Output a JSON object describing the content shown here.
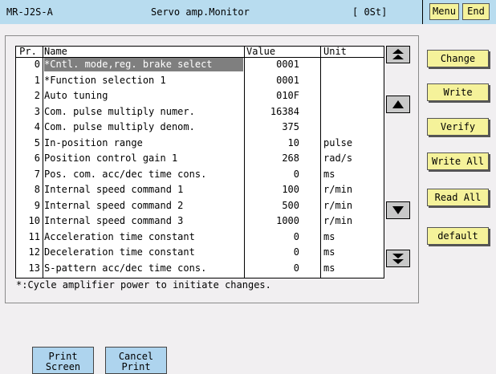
{
  "title_bar": {
    "app_name": "MR-J2S-A",
    "screen_name": "Servo amp.Monitor",
    "station": "[ 0St]",
    "menu_label": "Menu",
    "end_label": "End"
  },
  "table": {
    "columns": [
      "Pr.",
      "Name",
      "Value",
      "Unit"
    ],
    "selected_index": 0,
    "rows": [
      {
        "pr": "0",
        "name": "*Cntl. mode,reg. brake select",
        "value": "0001",
        "unit": ""
      },
      {
        "pr": "1",
        "name": "*Function selection 1",
        "value": "0001",
        "unit": ""
      },
      {
        "pr": "2",
        "name": "Auto tuning",
        "value": "010F",
        "unit": ""
      },
      {
        "pr": "3",
        "name": "Com. pulse multiply numer.",
        "value": "16384",
        "unit": ""
      },
      {
        "pr": "4",
        "name": "Com. pulse multiply denom.",
        "value": "375",
        "unit": ""
      },
      {
        "pr": "5",
        "name": "In-position range",
        "value": "10",
        "unit": "pulse"
      },
      {
        "pr": "6",
        "name": "Position control gain 1",
        "value": "268",
        "unit": "rad/s"
      },
      {
        "pr": "7",
        "name": "Pos. com. acc/dec time cons.",
        "value": "0",
        "unit": "ms"
      },
      {
        "pr": "8",
        "name": "Internal speed command 1",
        "value": "100",
        "unit": "r/min"
      },
      {
        "pr": "9",
        "name": "Internal speed command 2",
        "value": "500",
        "unit": "r/min"
      },
      {
        "pr": "10",
        "name": "Internal speed command 3",
        "value": "1000",
        "unit": "r/min"
      },
      {
        "pr": "11",
        "name": "Acceleration time constant",
        "value": "0",
        "unit": "ms"
      },
      {
        "pr": "12",
        "name": "Deceleration time constant",
        "value": "0",
        "unit": "ms"
      },
      {
        "pr": "13",
        "name": "S-pattern acc/dec time cons.",
        "value": "0",
        "unit": "ms"
      }
    ]
  },
  "note": "*:Cycle amplifier power to initiate changes.",
  "side_buttons": {
    "change": "Change",
    "write": "Write",
    "verify": "Verify",
    "write_all": "Write All",
    "read_all": "Read All",
    "default": "default"
  },
  "bottom_buttons": {
    "print_line1": "Print",
    "print_line2": "Screen",
    "cancel_line1": "Cancel",
    "cancel_line2": "Print"
  },
  "scroll_icons": [
    "page-up-icon",
    "line-up-icon",
    "line-down-icon",
    "page-down-icon"
  ],
  "colors": {
    "title_bar": "#b8dcef",
    "button_yellow": "#f5f29a",
    "button_blue": "#aed4ee",
    "selection": "#7f7f7f",
    "background": "#f1eff1"
  }
}
